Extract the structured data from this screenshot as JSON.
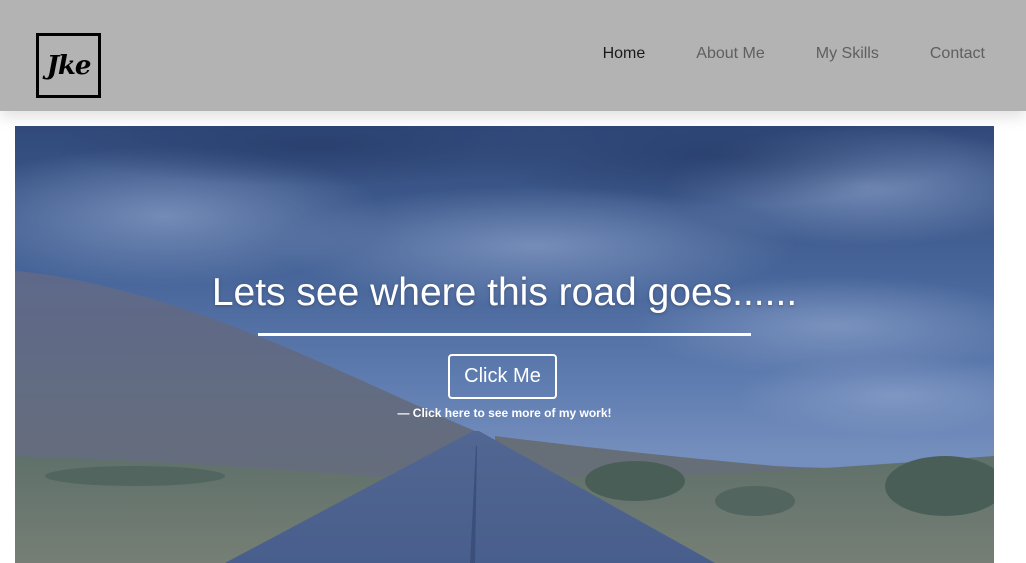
{
  "header": {
    "logo_text": "Jke",
    "nav": [
      {
        "label": "Home",
        "active": true
      },
      {
        "label": "About Me",
        "active": false
      },
      {
        "label": "My Skills",
        "active": false
      },
      {
        "label": "Contact",
        "active": false
      }
    ]
  },
  "hero": {
    "title": "Lets see where this road goes......",
    "button_label": "Click Me",
    "caption": "— Click here to see more of my work!"
  },
  "colors": {
    "navbar_bg": "#b3b3b4",
    "nav_active": "#1a1a1a",
    "nav_inactive": "#5f5f5f",
    "hero_text": "#ffffff"
  }
}
